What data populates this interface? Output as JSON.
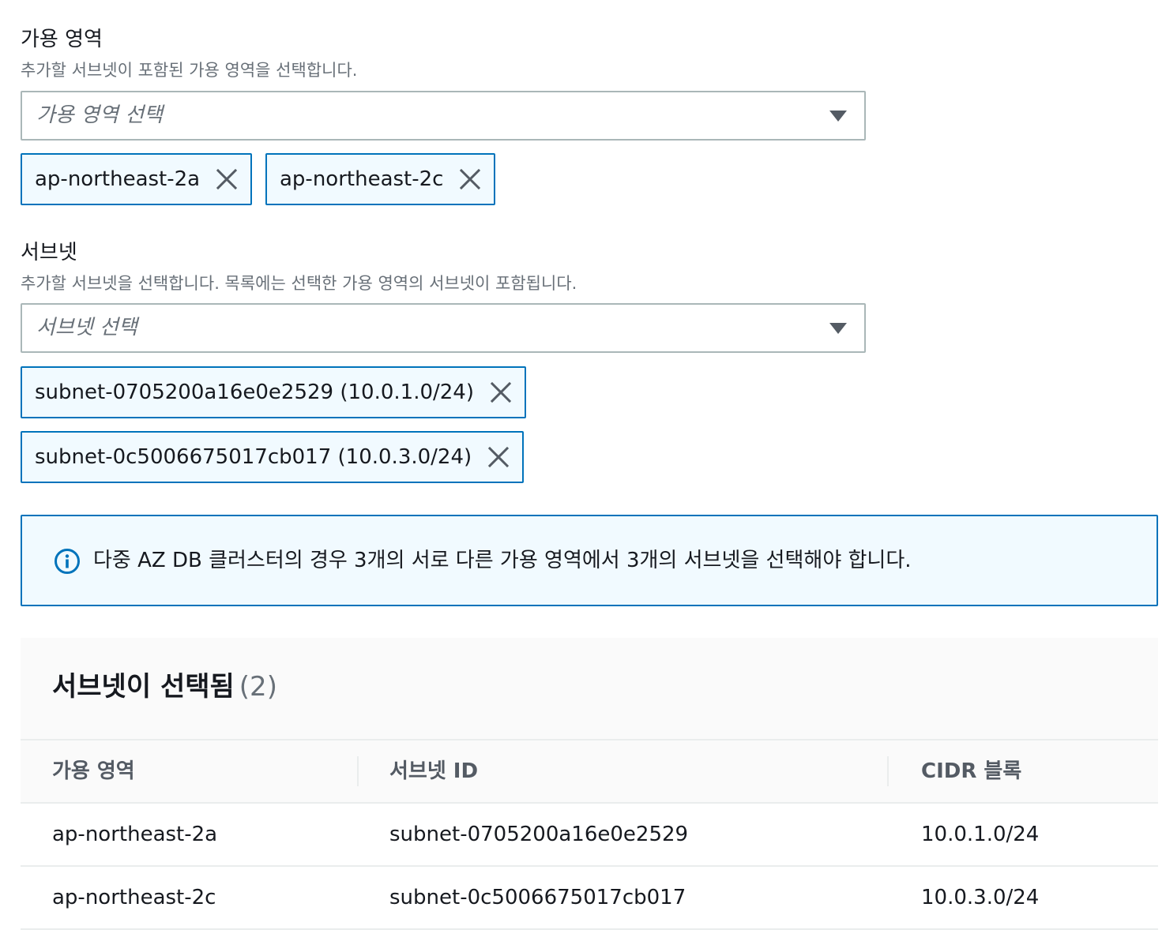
{
  "availability_zone": {
    "label": "가용 영역",
    "description": "추가할 서브넷이 포함된 가용 영역을 선택합니다.",
    "placeholder": "가용 영역 선택",
    "tokens": [
      "ap-northeast-2a",
      "ap-northeast-2c"
    ]
  },
  "subnet": {
    "label": "서브넷",
    "description": "추가할 서브넷을 선택합니다. 목록에는 선택한 가용 영역의 서브넷이 포함됩니다.",
    "placeholder": "서브넷 선택",
    "tokens": [
      "subnet-0705200a16e0e2529 (10.0.1.0/24)",
      "subnet-0c5006675017cb017 (10.0.3.0/24)"
    ]
  },
  "info": {
    "icon": "info-icon",
    "text": "다중 AZ DB 클러스터의 경우 3개의 서로 다른 가용 영역에서 3개의 서브넷을 선택해야 합니다.",
    "accent": "#0073bb"
  },
  "selected_panel": {
    "title": "서브넷이 선택됨",
    "count": "(2)",
    "columns": [
      "가용 영역",
      "서브넷 ID",
      "CIDR 블록"
    ],
    "rows": [
      [
        "ap-northeast-2a",
        "subnet-0705200a16e0e2529",
        "10.0.1.0/24"
      ],
      [
        "ap-northeast-2c",
        "subnet-0c5006675017cb017",
        "10.0.3.0/24"
      ]
    ]
  }
}
